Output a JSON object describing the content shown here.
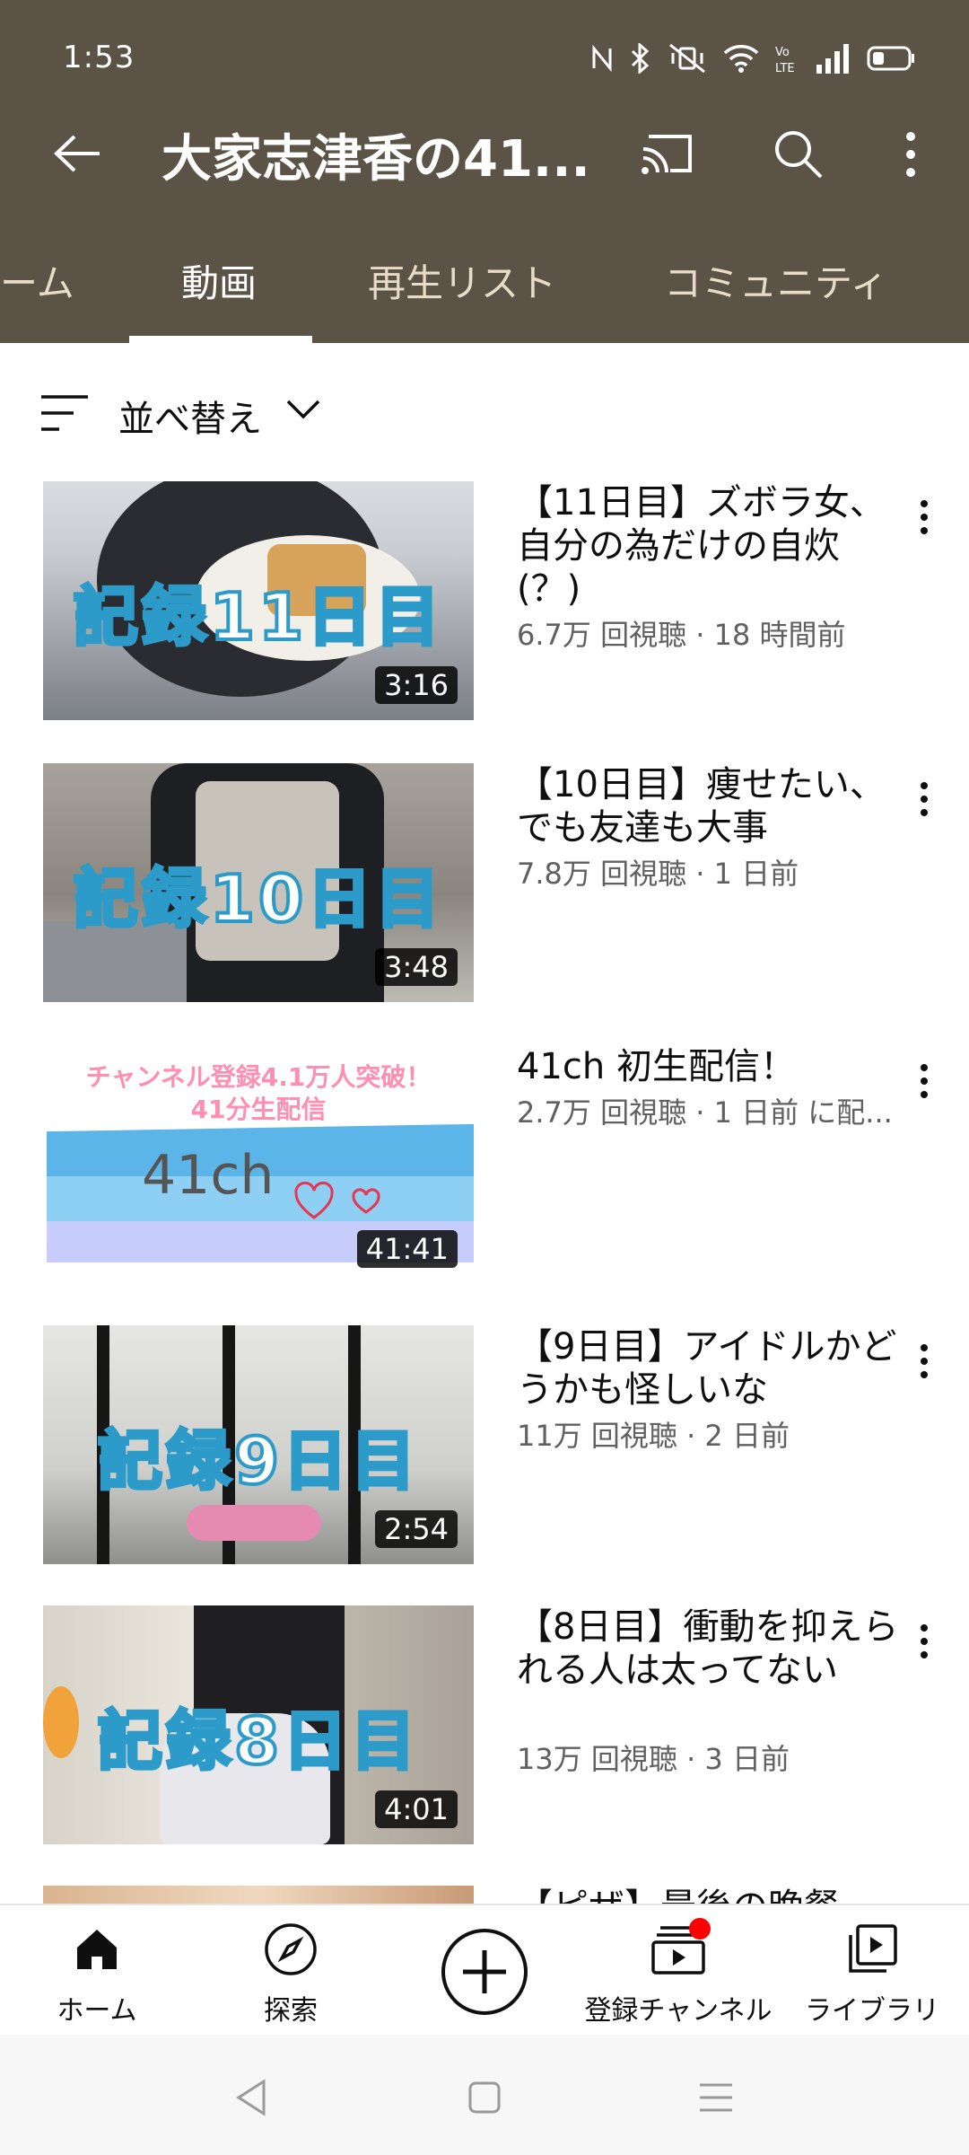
{
  "status_bar": {
    "time": "1:53"
  },
  "header": {
    "channel_title": "大家志津香の41..."
  },
  "tabs": [
    {
      "label": "ーム"
    },
    {
      "label": "動画",
      "active": true
    },
    {
      "label": "再生リスト"
    },
    {
      "label": "コミュニティ"
    }
  ],
  "sort": {
    "label": "並べ替え"
  },
  "videos": [
    {
      "title": "【11日目】ズボラ女、自分の為だけの自炊(？)",
      "meta": "6.7万 回視聴 · 18 時間前",
      "duration": "3:16",
      "thumb_text": "記録11日目"
    },
    {
      "title": "【10日目】痩せたい、でも友達も大事",
      "meta": "7.8万 回視聴 · 1 日前",
      "duration": "3:48",
      "thumb_text": "記録10日目"
    },
    {
      "title": "41ch 初生配信！",
      "meta": "2.7万 回視聴 · 1 日前 に配...",
      "duration": "41:41",
      "thumb_line1": "チャンネル登録4.1万人突破！",
      "thumb_line2": "41分生配信",
      "thumb_logo": "41ch"
    },
    {
      "title": "【9日目】アイドルかどうかも怪しいな",
      "meta": "11万 回視聴 · 2 日前",
      "duration": "2:54",
      "thumb_text": "記録9日目"
    },
    {
      "title": "【8日目】衝動を抑えられる人は太ってない",
      "meta": "13万 回視聴 · 3 日前",
      "duration": "4:01",
      "thumb_text": "記録8日目"
    },
    {
      "title": "【ピザ】最後の晩餐"
    }
  ],
  "bottom_nav": [
    {
      "label": "ホーム",
      "icon": "home-icon"
    },
    {
      "label": "探索",
      "icon": "explore-icon"
    },
    {
      "label": "",
      "icon": "create-icon"
    },
    {
      "label": "登録チャンネル",
      "icon": "subscriptions-icon"
    },
    {
      "label": "ライブラリ",
      "icon": "library-icon"
    }
  ],
  "colors": {
    "header_bg": "#5b5346",
    "accent_red": "#ff0000",
    "thumb_text_stroke": "#2d9bc9"
  }
}
